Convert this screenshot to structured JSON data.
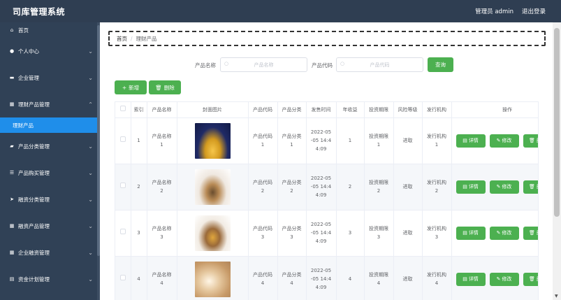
{
  "app": {
    "title": "司库管理系统"
  },
  "header": {
    "user": "管理员 admin",
    "logout": "退出登录"
  },
  "sidebar": {
    "home": {
      "label": "首页",
      "icon": "home-icon"
    },
    "items": [
      {
        "label": "个人中心",
        "icon": "user-icon"
      },
      {
        "label": "企业管理",
        "icon": "building-icon"
      },
      {
        "label": "理财产品管理",
        "icon": "grid-icon",
        "children": [
          "理财产品"
        ]
      },
      {
        "label": "产品分类管理",
        "icon": "tag-icon"
      },
      {
        "label": "产品购买管理",
        "icon": "sliders-icon"
      },
      {
        "label": "融资分类管理",
        "icon": "send-icon"
      },
      {
        "label": "融资产品管理",
        "icon": "grid-icon"
      },
      {
        "label": "企业融资管理",
        "icon": "grid-icon"
      },
      {
        "label": "资金计划管理",
        "icon": "doc-icon"
      }
    ]
  },
  "breadcrumb": {
    "home": "首页",
    "sep": "/",
    "current": "理财产品"
  },
  "search": {
    "name_label": "产品名称",
    "name_placeholder": "产品名称",
    "code_label": "产品代码",
    "code_placeholder": "产品代码",
    "query_button": "查询"
  },
  "actions": {
    "add": "新增",
    "delete": "删除"
  },
  "table": {
    "headers": [
      "",
      "索引",
      "产品名称",
      "封面图片",
      "产品代码",
      "产品分类",
      "发售时间",
      "年收益",
      "投资期限",
      "风险等级",
      "发行机构",
      "操作"
    ],
    "row_buttons": {
      "detail": "详情",
      "edit": "修改",
      "delete": "删除"
    },
    "rows": [
      {
        "index": "1",
        "name": "产品名称\n1",
        "code": "产品代码\n1",
        "category": "产品分类\n1",
        "date": "2022-05\n-05 14:4\n4:09",
        "yield": "1",
        "term": "投资期限\n1",
        "risk": "进取",
        "issuer": "发行机构\n1"
      },
      {
        "index": "2",
        "name": "产品名称\n2",
        "code": "产品代码\n2",
        "category": "产品分类\n2",
        "date": "2022-05\n-05 14:4\n4:09",
        "yield": "2",
        "term": "投资期限\n2",
        "risk": "进取",
        "issuer": "发行机构\n2"
      },
      {
        "index": "3",
        "name": "产品名称\n3",
        "code": "产品代码\n3",
        "category": "产品分类\n3",
        "date": "2022-05\n-05 14:4\n4:09",
        "yield": "3",
        "term": "投资期限\n3",
        "risk": "进取",
        "issuer": "发行机构\n3"
      },
      {
        "index": "4",
        "name": "产品名称\n4",
        "code": "产品代码\n4",
        "category": "产品分类\n4",
        "date": "2022-05\n-05 14:4\n4:09",
        "yield": "4",
        "term": "投资期限\n4",
        "risk": "进取",
        "issuer": "发行机构\n4"
      }
    ]
  },
  "colors": {
    "header_bg": "#2f3e52",
    "sidebar_bg": "#304156",
    "active": "#1f8eea",
    "button_green": "#4cb050"
  }
}
